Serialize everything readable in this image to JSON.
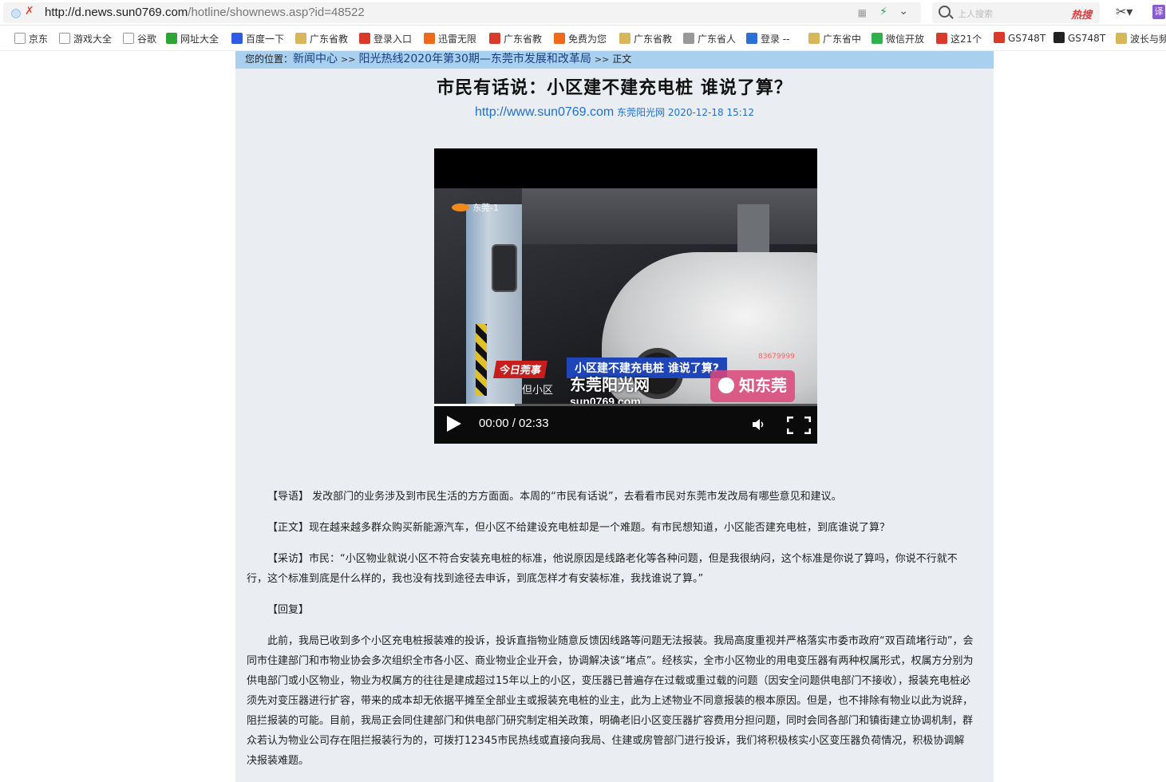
{
  "browser": {
    "url_domain": "http://d.news.sun0769.com",
    "url_path": "/hotline/shownews.asp?id=48522",
    "search_placeholder": "上人搜索",
    "search_hot": "热搜",
    "translate_label": "译"
  },
  "bookmarks": [
    {
      "label": "京东",
      "color": "#ffffff"
    },
    {
      "label": "游戏大全",
      "color": "#ffffff"
    },
    {
      "label": "谷歌",
      "color": "#ffffff"
    },
    {
      "label": "网址大全",
      "color": "#2fa536"
    },
    {
      "label": "百度一下",
      "color": "#2d5be3"
    },
    {
      "label": "广东省教",
      "color": "#d8b65a"
    },
    {
      "label": "登录入口",
      "color": "#d93a2a"
    },
    {
      "label": "迅雷无限",
      "color": "#f06a1c"
    },
    {
      "label": "广东省教",
      "color": "#d93a2a"
    },
    {
      "label": "免费为您",
      "color": "#f06a1c"
    },
    {
      "label": "广东省教",
      "color": "#d8b65a"
    },
    {
      "label": "广东省人",
      "color": "#999999"
    },
    {
      "label": "登录 --",
      "color": "#2c6fd6"
    },
    {
      "label": "广东省中",
      "color": "#d8b65a"
    },
    {
      "label": "微信开放",
      "color": "#2fb24c"
    },
    {
      "label": "这21个",
      "color": "#d93a2a"
    },
    {
      "label": "GS748T",
      "color": "#d93a2a"
    },
    {
      "label": "GS748T",
      "color": "#222222"
    },
    {
      "label": "波长与频",
      "color": "#d8b65a"
    }
  ],
  "breadcrumb": {
    "prefix": "您的位置：",
    "items": [
      "新闻中心",
      "阳光热线2020年第30期—东莞市发展和改革局"
    ],
    "current": "正文",
    "sep": ">>"
  },
  "article": {
    "title": "市民有话说：小区建不建充电桩  谁说了算？",
    "site": "http://www.sun0769.com",
    "source": "东莞阳光网",
    "datetime": "2020-12-18 15:12"
  },
  "video": {
    "time": "00:00 / 02:33",
    "progress": 0.21,
    "channel": "东莞-1",
    "banner_red": "今日莞事",
    "banner_blue": "小区建不建充电桩 谁说了算?",
    "caption": "但小区",
    "watermark_sun": "东莞阳光网",
    "watermark_sun_url": "sun0769.com",
    "watermark_zdg": "知东莞",
    "phone": "83679999"
  },
  "paragraphs": [
    "【导语】 发改部门的业务涉及到市民生活的方方面面。本周的“市民有话说”，去看看市民对东莞市发改局有哪些意见和建议。",
    "【正文】现在越来越多群众购买新能源汽车，但小区不给建设充电桩却是一个难题。有市民想知道，小区能否建充电桩，到底谁说了算？",
    "【采访】市民：“小区物业就说小区不符合安装充电桩的标准，他说原因是线路老化等各种问题，但是我很纳闷，这个标准是你说了算吗，你说不行就不行，这个标准到底是什么样的，我也没有找到途径去申诉，到底怎样才有安装标准，我找谁说了算。”",
    "【回复】",
    "此前，我局已收到多个小区充电桩报装难的投诉，投诉直指物业随意反馈因线路等问题无法报装。我局高度重视并严格落实市委市政府“双百疏堵行动”，会同市住建部门和市物业协会多次组织全市各小区、商业物业企业开会，协调解决该“堵点”。经核实，全市小区物业的用电变压器有两种权属形式，权属方分别为供电部门或小区物业，物业为权属方的往往是建成超过15年以上的小区，变压器已普遍存在过载或重过载的问题（因安全问题供电部门不接收），报装充电桩必须先对变压器进行扩容，带来的成本却无依据平摊至全部业主或报装充电桩的业主，此为上述物业不同意报装的根本原因。但是，也不排除有物业以此为说辞，阻拦报装的可能。目前，我局正会同住建部门和供电部门研究制定相关政策，明确老旧小区变压器扩容费用分担问题，同时会同各部门和镇街建立协调机制，群众若认为物业公司存在阻拦报装行为的，可拨打12345市民热线或直接向我局、住建或房管部门进行投诉，我们将积极核实小区变压器负荷情况，积极协调解决报装难题。"
  ]
}
